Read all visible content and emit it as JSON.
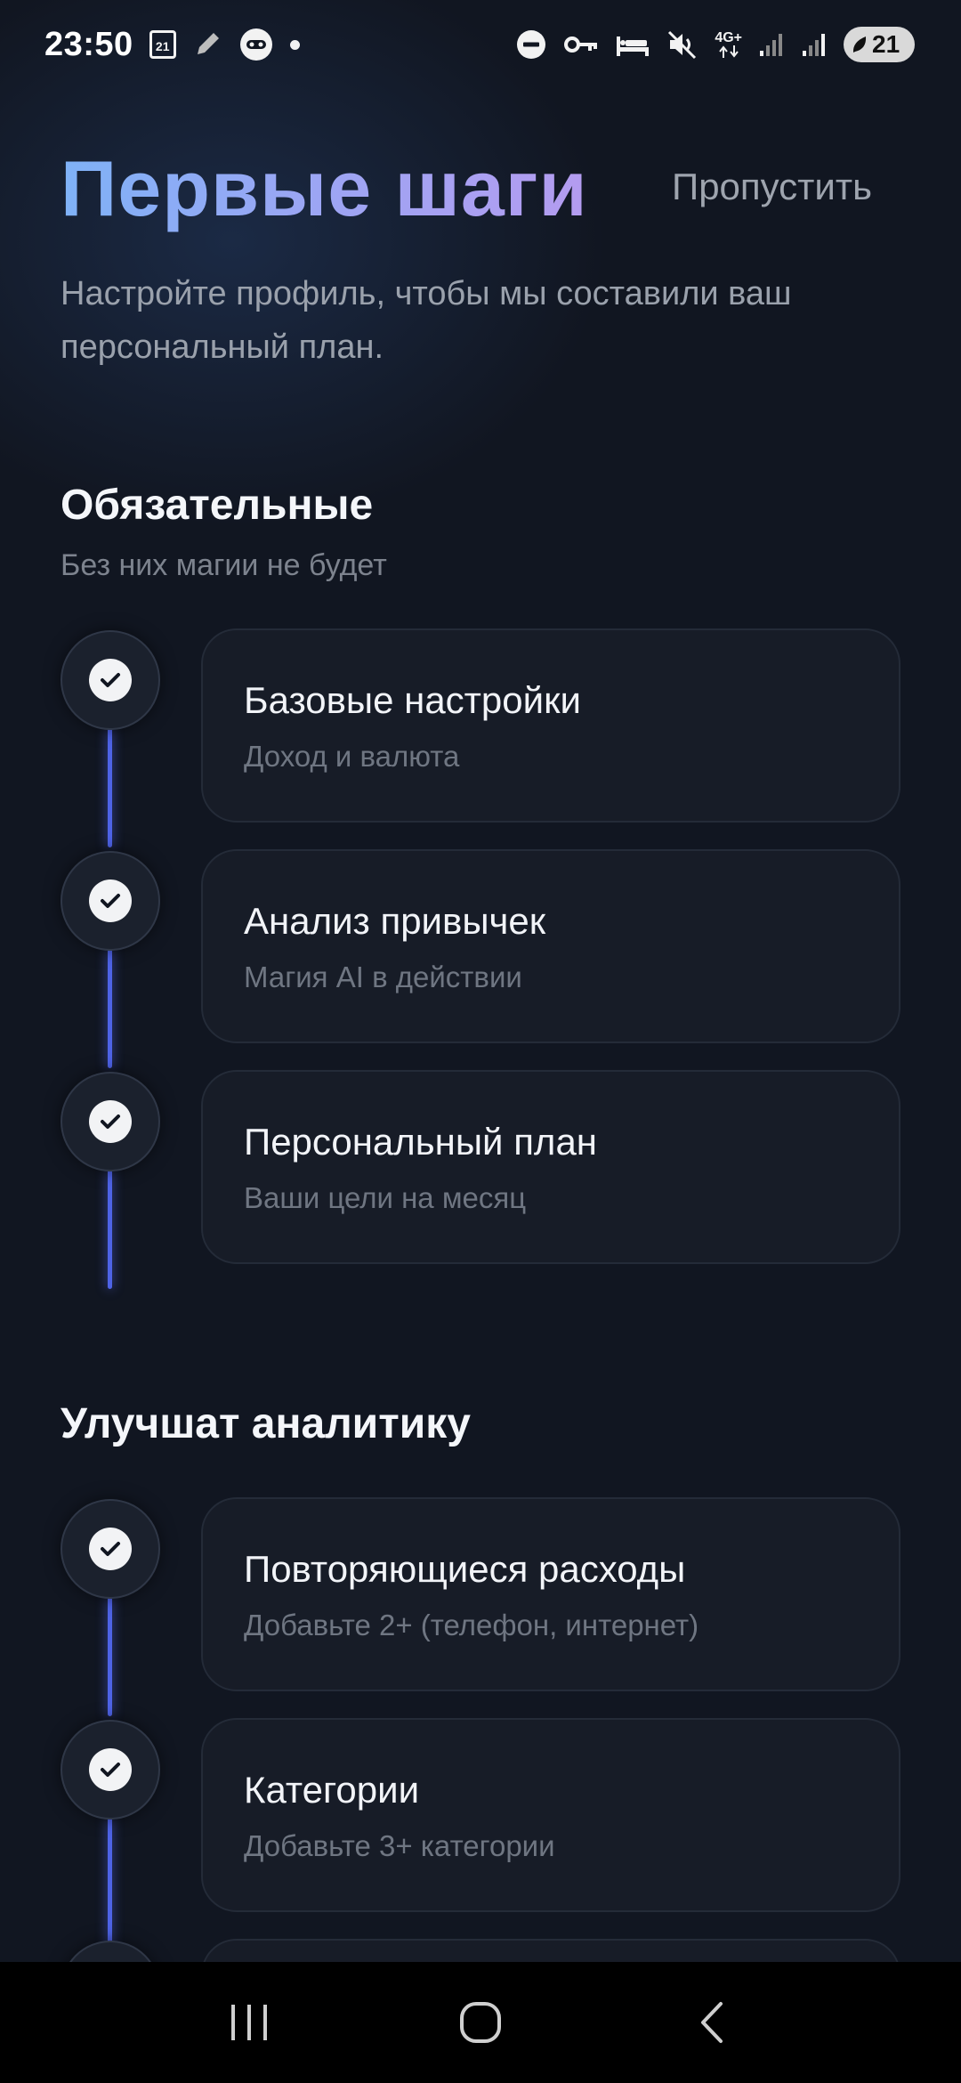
{
  "status_bar": {
    "time": "23:50",
    "calendar_day": "21",
    "network": "4G+",
    "battery": "21"
  },
  "header": {
    "title": "Первые шаги",
    "skip_label": "Пропустить",
    "subtitle": "Настройте профиль, чтобы мы составили ваш персональный план."
  },
  "required_section": {
    "title": "Обязательные",
    "subtitle": "Без них магии не будет",
    "steps": [
      {
        "title": "Базовые настройки",
        "subtitle": "Доход и валюта",
        "done": true
      },
      {
        "title": "Анализ привычек",
        "subtitle": "Магия AI в действии",
        "done": true
      },
      {
        "title": "Персональный план",
        "subtitle": "Ваши цели на месяц",
        "done": true
      }
    ]
  },
  "analytics_section": {
    "title": "Улучшат аналитику",
    "steps": [
      {
        "title": "Повторяющиеся расходы",
        "subtitle": "Добавьте 2+ (телефон, интернет)",
        "done": true
      },
      {
        "title": "Категории",
        "subtitle": "Добавьте 3+ категории",
        "done": true
      }
    ]
  },
  "icons": {
    "check": "check-icon",
    "nav_recents": "recents-icon",
    "nav_home": "home-icon",
    "nav_back": "back-icon"
  },
  "colors": {
    "background": "#111621",
    "accent_line": "#4e63e6",
    "title_gradient_start": "#7fb2f7",
    "title_gradient_end": "#b49cf0"
  }
}
